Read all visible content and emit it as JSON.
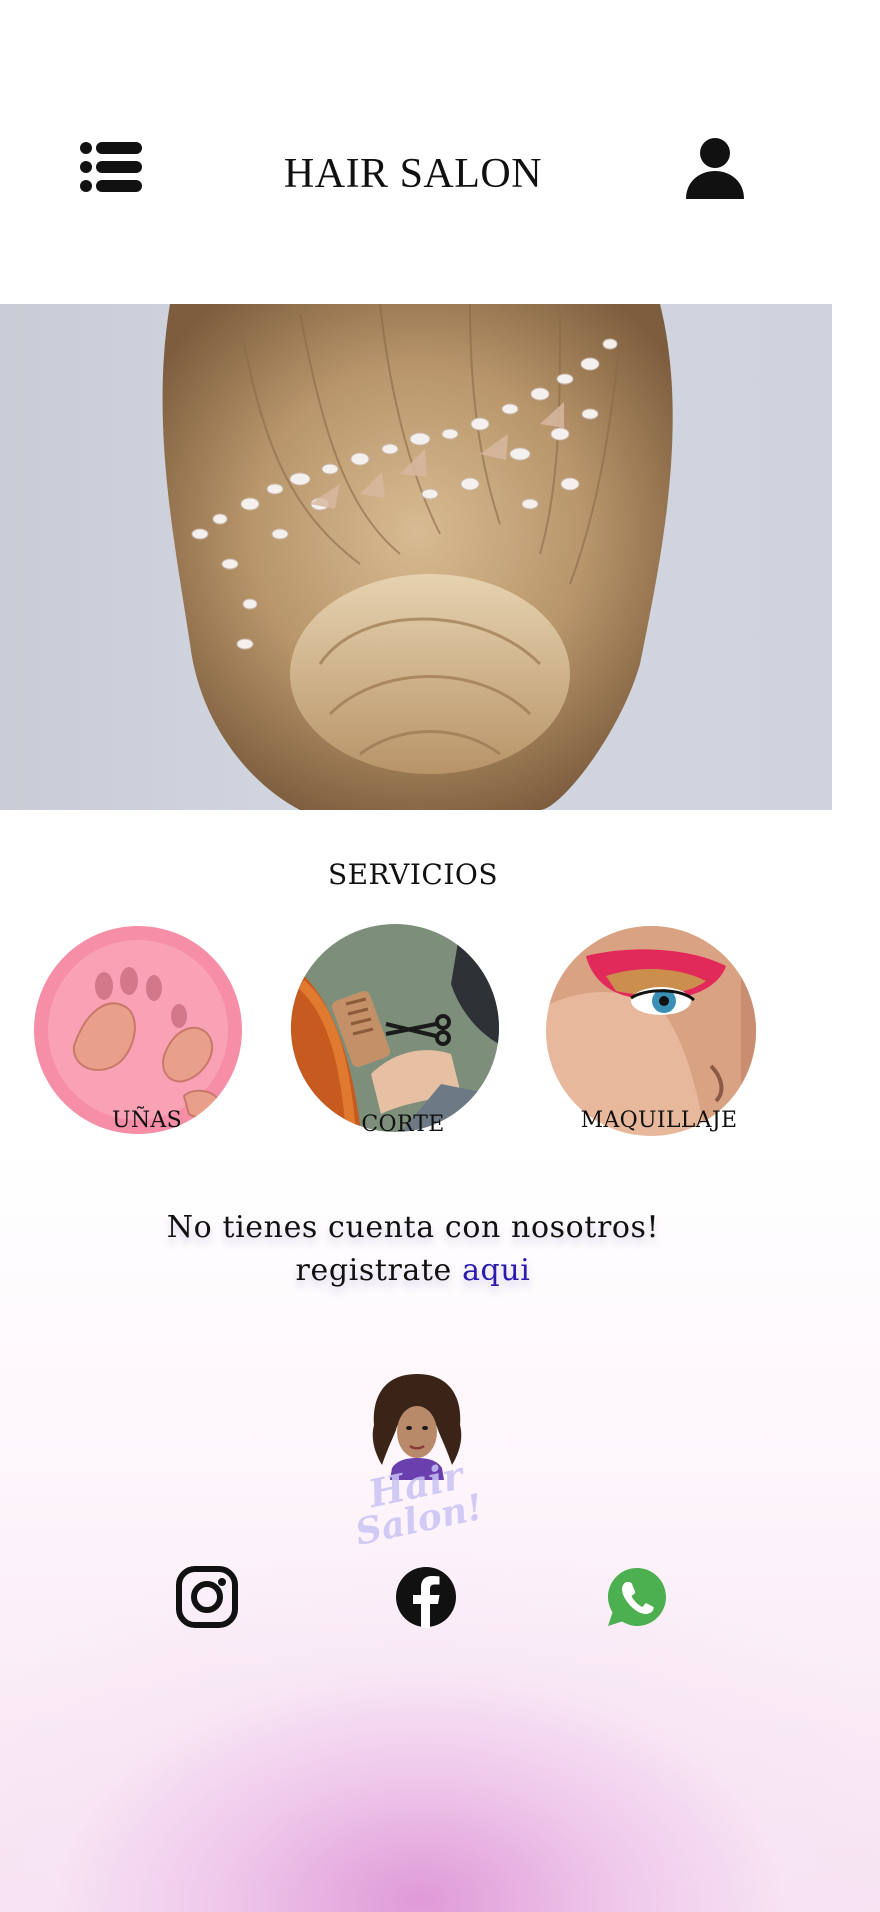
{
  "header": {
    "title": "HAIR SALON",
    "menu_icon": "menu-list-icon",
    "user_icon": "user-icon"
  },
  "hero": {
    "image": "bride-hair-updo-with-pearl-hairpiece"
  },
  "services": {
    "title": "SERVICIOS",
    "items": [
      {
        "label": "UÑAS",
        "image": "pink-nails-photo"
      },
      {
        "label": "CORTE",
        "image": "haircut-comb-scissors-photo"
      },
      {
        "label": "MAQUILLAJE",
        "image": "eye-makeup-photo"
      }
    ]
  },
  "signup": {
    "line1": "No tienes cuenta con nosotros!",
    "line2_prefix": "registrate",
    "link_text": "aqui"
  },
  "logo": {
    "text_line1": "Hair",
    "text_line2": "Salon!"
  },
  "social": [
    {
      "name": "instagram-icon",
      "color": "#111111"
    },
    {
      "name": "facebook-icon",
      "color": "#111111"
    },
    {
      "name": "whatsapp-icon",
      "color": "#4caf50"
    }
  ],
  "colors": {
    "link": "#2a1ab0",
    "gradient_bottom": "#e09ad6"
  }
}
